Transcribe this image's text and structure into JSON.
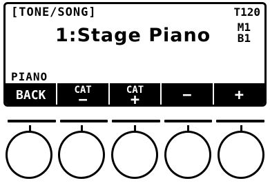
{
  "lcd": {
    "mode_label": "[TONE/SONG]",
    "tempo": "T120",
    "m_indicator": "M1",
    "b_indicator": "B1",
    "tone_name": "1:Stage Piano",
    "category": "PIANO"
  },
  "softkeys": [
    {
      "name": "back",
      "top": "",
      "bottom": "BACK",
      "single": "BACK"
    },
    {
      "name": "cat-minus",
      "top": "CAT",
      "bottom": "−"
    },
    {
      "name": "cat-plus",
      "top": "CAT",
      "bottom": "+"
    },
    {
      "name": "minus",
      "single": "−"
    },
    {
      "name": "plus",
      "single": "+"
    }
  ],
  "colors": {
    "lcd_bg": "#ffffff",
    "ink": "#000000",
    "softkey_text": "#ffffff"
  }
}
